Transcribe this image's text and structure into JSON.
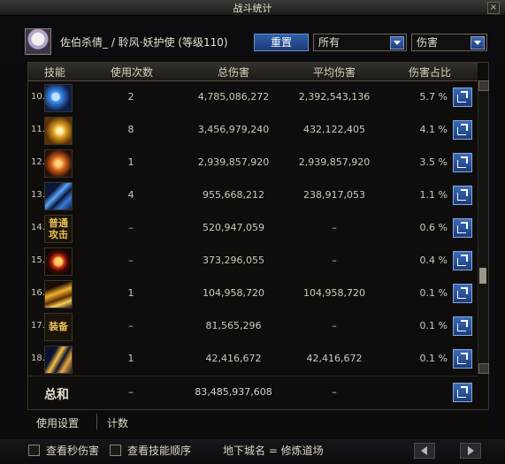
{
  "window": {
    "title": "战斗统计",
    "close": "×"
  },
  "header": {
    "character": "佐伯杀倩_ / 聆风·妖护使 (等级110)",
    "reset_label": "重置",
    "scope_select": "所有",
    "type_select": "伤害"
  },
  "columns": [
    "技能",
    "使用次数",
    "总伤害",
    "平均伤害",
    "伤害占比"
  ],
  "rows": [
    {
      "index": "10.",
      "icon": "blue-claw-skill-icon",
      "icon_text": "",
      "uses": "2",
      "total": "4,785,086,272",
      "avg": "2,392,543,136",
      "pct": "5.7 %"
    },
    {
      "index": "11.",
      "icon": "golden-swirl-skill-icon",
      "icon_text": "",
      "uses": "8",
      "total": "3,456,979,240",
      "avg": "432,122,405",
      "pct": "4.1 %"
    },
    {
      "index": "12.",
      "icon": "fire-claw-skill-icon",
      "icon_text": "",
      "uses": "1",
      "total": "2,939,857,920",
      "avg": "2,939,857,920",
      "pct": "3.5 %"
    },
    {
      "index": "13.",
      "icon": "blue-slash-skill-icon",
      "icon_text": "",
      "uses": "4",
      "total": "955,668,212",
      "avg": "238,917,053",
      "pct": "1.1 %"
    },
    {
      "index": "14.",
      "icon": "normal-attack-icon",
      "icon_text": "普通攻击",
      "uses": "–",
      "total": "520,947,059",
      "avg": "–",
      "pct": "0.6 %"
    },
    {
      "index": "15.",
      "icon": "red-emblem-skill-icon",
      "icon_text": "",
      "uses": "–",
      "total": "373,296,055",
      "avg": "–",
      "pct": "0.4 %"
    },
    {
      "index": "16.",
      "icon": "golden-flame-skill-icon",
      "icon_text": "",
      "uses": "1",
      "total": "104,958,720",
      "avg": "104,958,720",
      "pct": "0.1 %"
    },
    {
      "index": "17.",
      "icon": "equipment-icon",
      "icon_text": "装备",
      "uses": "–",
      "total": "81,565,296",
      "avg": "–",
      "pct": "0.1 %"
    },
    {
      "index": "18.",
      "icon": "golden-strike-skill-icon",
      "icon_text": "",
      "uses": "1",
      "total": "42,416,672",
      "avg": "42,416,672",
      "pct": "0.1 %"
    }
  ],
  "total_row": {
    "label": "总和",
    "uses": "–",
    "total": "83,485,937,608",
    "avg": "–"
  },
  "bottom_tabs": [
    "使用设置",
    "计数"
  ],
  "footer": {
    "check_dps": "查看秒伤害",
    "check_order": "查看技能顺序",
    "dungeon": "地下城名 = 修炼道场"
  },
  "colors": {
    "accent_blue": "#2e5fa8",
    "panel": "#0e0d0c",
    "gold_text": "#e8c15a"
  }
}
